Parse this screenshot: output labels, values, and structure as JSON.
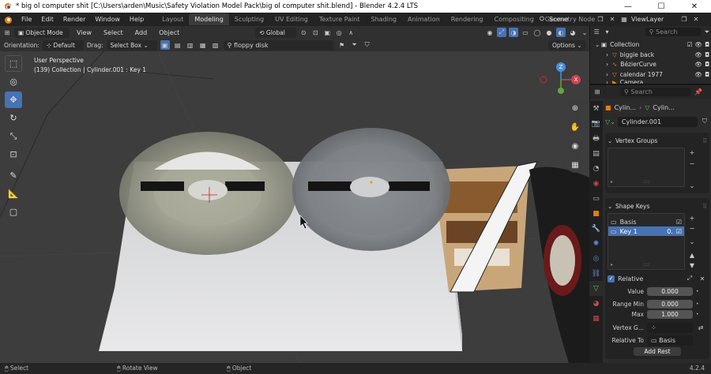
{
  "window": {
    "title": "* big ol computer shit [C:\\Users\\arden\\Music\\Safety Violation Model Pack\\big ol computer shit.blend] - Blender 4.2.4 LTS",
    "minimize": "—",
    "maximize": "☐",
    "close": "✕"
  },
  "menus": [
    "File",
    "Edit",
    "Render",
    "Window",
    "Help"
  ],
  "workspaces": [
    {
      "label": "Layout",
      "active": false
    },
    {
      "label": "Modeling",
      "active": true
    },
    {
      "label": "Sculpting",
      "active": false
    },
    {
      "label": "UV Editing",
      "active": false
    },
    {
      "label": "Texture Paint",
      "active": false
    },
    {
      "label": "Shading",
      "active": false
    },
    {
      "label": "Animation",
      "active": false
    },
    {
      "label": "Rendering",
      "active": false
    },
    {
      "label": "Compositing",
      "active": false
    },
    {
      "label": "Geometry Node",
      "active": false
    }
  ],
  "scene": {
    "name": "Scene",
    "view_layer": "ViewLayer"
  },
  "header": {
    "mode": "Object Mode",
    "menus": [
      "View",
      "Select",
      "Add",
      "Object"
    ],
    "transform": "Global",
    "orientation_label": "Orientation:",
    "orientation": "Default",
    "drag_label": "Drag:",
    "drag": "Select Box",
    "search_value": "floppy disk",
    "options": "Options"
  },
  "viewport": {
    "perspective": "User Perspective",
    "collection_info": "(139) Collection | Cylinder.001 : Key 1"
  },
  "gizmo": {
    "z": "Z",
    "y": "Y",
    "x": "X"
  },
  "outliner": {
    "search_placeholder": "Search",
    "items": [
      {
        "label": "Collection",
        "level": 0
      },
      {
        "label": "biggie back",
        "level": 1
      },
      {
        "label": "BézierCurve",
        "level": 1
      },
      {
        "label": "calendar 1977",
        "level": 1
      },
      {
        "label": "Camera",
        "level": 1
      }
    ]
  },
  "properties": {
    "search_placeholder": "Search",
    "breadcrumb": [
      "Cylin...",
      "Cylin..."
    ],
    "object_data_name": "Cylinder.001",
    "vertex_groups_title": "Vertex Groups",
    "shape_keys_title": "Shape Keys",
    "shape_keys": [
      {
        "label": "Basis",
        "value": "",
        "selected": false
      },
      {
        "label": "Key 1",
        "value": "0.",
        "selected": true
      }
    ],
    "relative_label": "Relative",
    "relative_checked": true,
    "value_label": "Value",
    "value": "0.000",
    "range_min_label": "Range Min",
    "range_min": "0.000",
    "max_label": "Max",
    "max": "1.000",
    "vertex_group_label": "Vertex G...",
    "relative_to_label": "Relative To",
    "relative_to": "Basis",
    "add_rest": "Add Rest"
  },
  "status": {
    "select": "Select",
    "rotate_view": "Rotate View",
    "object": "Object",
    "version": "4.2.4"
  },
  "colors": {
    "accent": "#4772b3",
    "orange": "#e87d0d",
    "panel": "#2b2b2b"
  }
}
